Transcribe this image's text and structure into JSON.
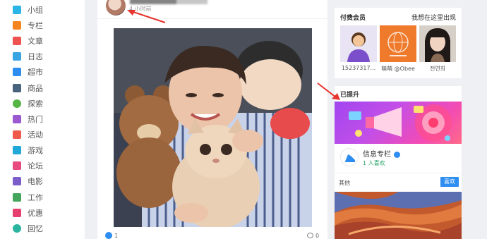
{
  "sidebar": {
    "items": [
      {
        "label": "小组",
        "icon": "group-icon",
        "color": "#2bb4e6"
      },
      {
        "label": "专栏",
        "icon": "flag-icon",
        "color": "#f7851e"
      },
      {
        "label": "文章",
        "icon": "article-icon",
        "color": "#ee5350"
      },
      {
        "label": "日志",
        "icon": "log-icon",
        "color": "#39a5e3"
      },
      {
        "label": "超市",
        "icon": "market-icon",
        "color": "#2e8df0"
      },
      {
        "label": "商品",
        "icon": "goods-icon",
        "color": "#47637e"
      },
      {
        "label": "探索",
        "icon": "explore-icon",
        "color": "#57b546"
      },
      {
        "label": "热门",
        "icon": "hot-icon",
        "color": "#9b59d0"
      },
      {
        "label": "活动",
        "icon": "event-icon",
        "color": "#ef5a4c"
      },
      {
        "label": "游戏",
        "icon": "game-icon",
        "color": "#1fa8d8"
      },
      {
        "label": "论坛",
        "icon": "forum-icon",
        "color": "#e84a7f"
      },
      {
        "label": "电影",
        "icon": "movie-icon",
        "color": "#7b5ec9"
      },
      {
        "label": "工作",
        "icon": "work-icon",
        "color": "#44a65a"
      },
      {
        "label": "优惠",
        "icon": "tag-icon",
        "color": "#e43f6f"
      },
      {
        "label": "回忆",
        "icon": "history-icon",
        "color": "#2bb4a0"
      }
    ]
  },
  "post": {
    "time": "4 小时前",
    "likes": "1",
    "comments": "0"
  },
  "paid_members": {
    "title": "付费会员",
    "cta": "我想在这里出现",
    "members": [
      {
        "name": "15237317...",
        "avatar": "user-silhouette-icon",
        "color": "#e9e4f3"
      },
      {
        "name": "萌萌 @Obee",
        "avatar": "logo-avatar",
        "color": "#f07a2c"
      },
      {
        "name": "전연희",
        "avatar": "photo-avatar",
        "color": "#d8d2cc"
      }
    ]
  },
  "promoted": {
    "title": "已提升",
    "column_name": "信息专栏",
    "column_likes": "1 人喜欢",
    "other_label": "其他",
    "like_button": "喜欢"
  },
  "colors": {
    "accent": "#2e8df0",
    "green": "#1ea362",
    "arrow": "#e8342f"
  }
}
